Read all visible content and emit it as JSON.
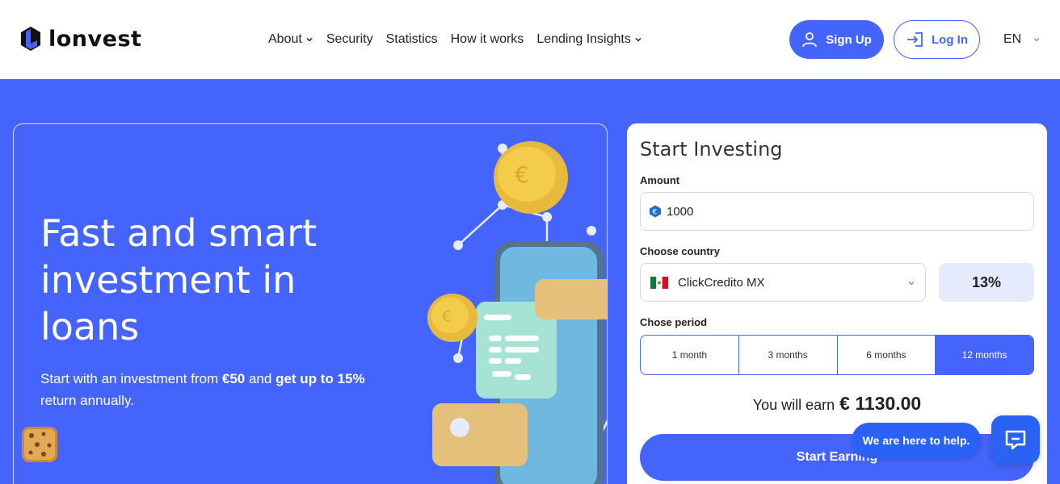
{
  "brand": {
    "name": "lonvest"
  },
  "nav": {
    "items": [
      {
        "label": "About",
        "has_dropdown": true
      },
      {
        "label": "Security",
        "has_dropdown": false
      },
      {
        "label": "Statistics",
        "has_dropdown": false
      },
      {
        "label": "How it works",
        "has_dropdown": false
      },
      {
        "label": "Lending Insights",
        "has_dropdown": true
      }
    ],
    "signup_label": "Sign Up",
    "login_label": "Log In",
    "language": "EN"
  },
  "hero": {
    "title": "Fast and smart investment in loans",
    "subtitle_parts": [
      "Start with an investment from ",
      "€50",
      " and ",
      "get up to 15%",
      " return annually."
    ]
  },
  "form": {
    "title": "Start Investing",
    "amount_label": "Amount",
    "amount_value": "1000",
    "country_label": "Choose country",
    "country_value": "ClickCredito MX",
    "rate": "13%",
    "period_label": "Chose period",
    "periods": [
      "1 month",
      "3 months",
      "6 months",
      "12 months"
    ],
    "selected_period": "12 months",
    "earn_label": "You will earn",
    "earn_amount": "€ 1130.00",
    "cta_label": "Start Earning"
  },
  "chat": {
    "bubble_text": "We are here to help."
  },
  "colors": {
    "primary": "#4564fb",
    "chat": "#2a62f6",
    "rate_bg": "#e6eafd"
  },
  "icons": [
    "logo-mark-icon",
    "chevron-down-icon",
    "user-icon",
    "login-icon",
    "euro-icon",
    "mexico-flag-icon",
    "chat-icon",
    "cookie-icon"
  ]
}
